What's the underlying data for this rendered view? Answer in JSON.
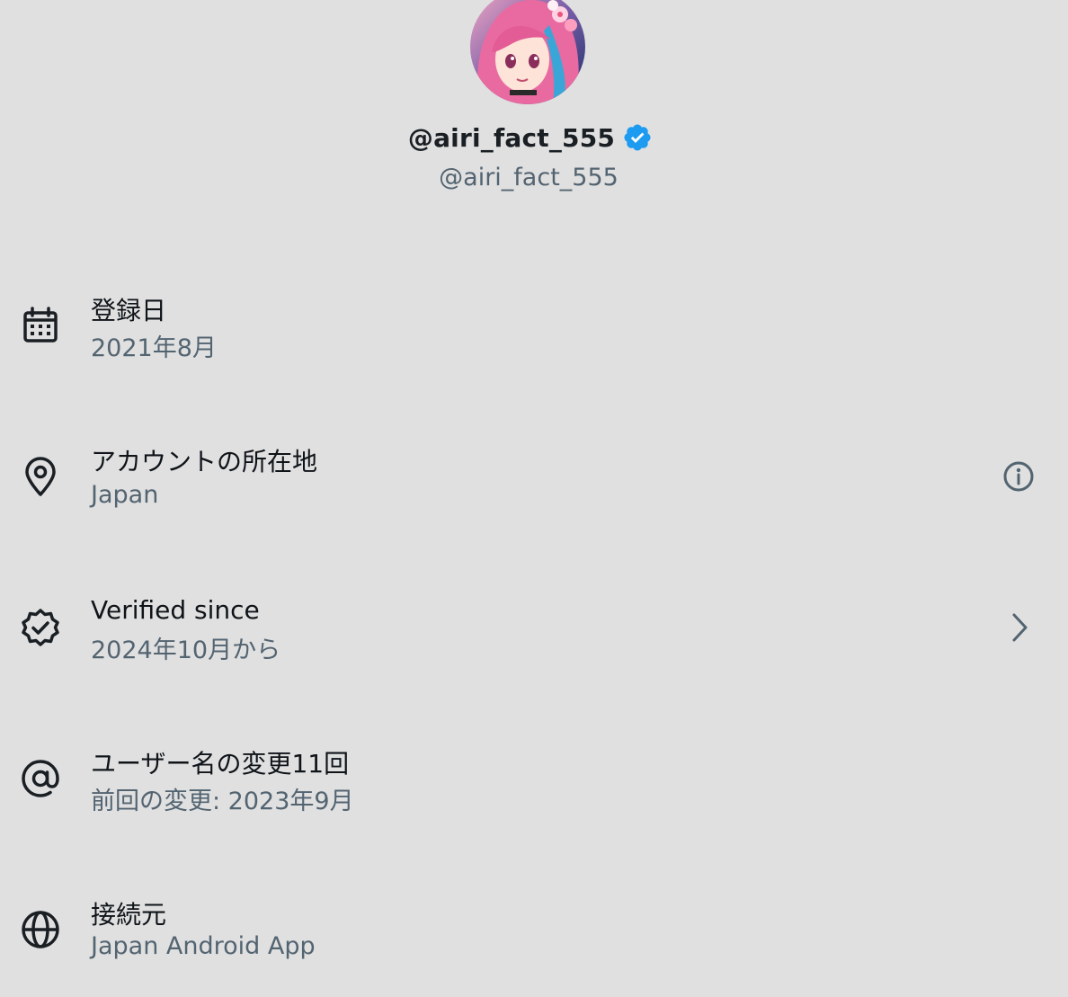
{
  "profile": {
    "display_name": "@airi_fact_555",
    "handle": "@airi_fact_555",
    "verified": true
  },
  "colors": {
    "background": "#e0e0e0",
    "verified_blue": "#1d9bf0",
    "primary_text": "#0f1419",
    "secondary_text": "#536471"
  },
  "rows": [
    {
      "icon": "calendar-icon",
      "title": "登録日",
      "subtitle": "2021年8月"
    },
    {
      "icon": "location-pin-icon",
      "title": "アカウントの所在地",
      "subtitle": "Japan",
      "action_icon": "info-icon"
    },
    {
      "icon": "verified-check-icon",
      "title": "Verified since",
      "subtitle": "2024年10月から",
      "action_icon": "chevron-right-icon"
    },
    {
      "icon": "at-sign-icon",
      "title": "ユーザー名の変更11回",
      "subtitle": "前回の変更: 2023年9月"
    },
    {
      "icon": "globe-icon",
      "title": "接続元",
      "subtitle": "Japan Android App"
    }
  ]
}
